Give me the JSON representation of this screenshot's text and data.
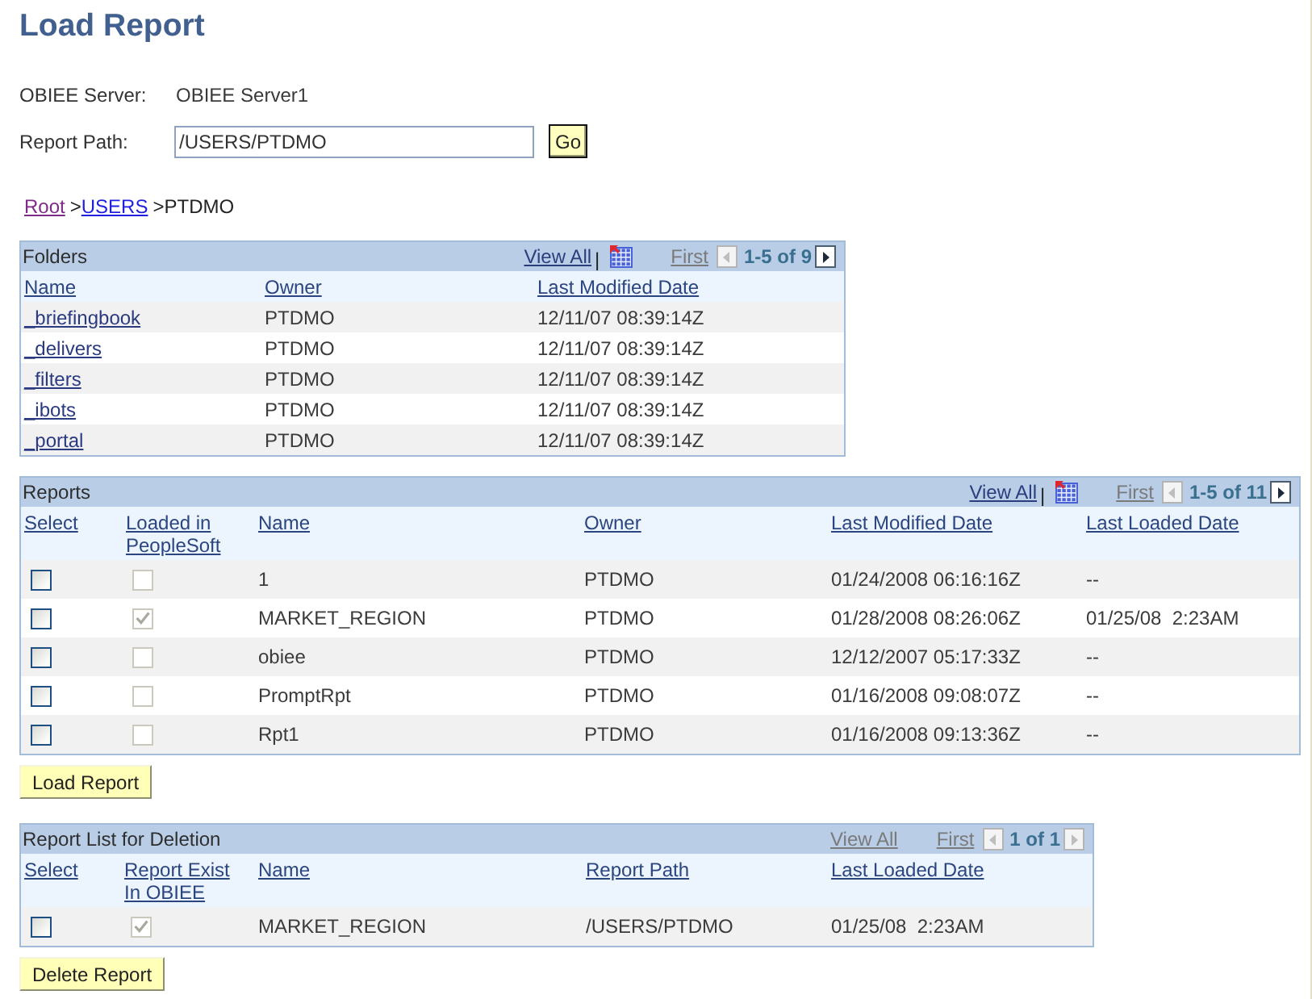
{
  "page": {
    "title": "Load Report"
  },
  "server": {
    "label": "OBIEE Server:",
    "value": "OBIEE Server1"
  },
  "report_path": {
    "label": "Report Path:",
    "value": "/USERS/PTDMO",
    "button": "Go"
  },
  "breadcrumb": [
    {
      "kind": "visited",
      "text": "Root"
    },
    {
      "kind": "separator",
      "text": ">"
    },
    {
      "kind": "link",
      "text": "USERS"
    },
    {
      "kind": "separator",
      "text": ">"
    },
    {
      "kind": "current",
      "text": "PTDMO"
    }
  ],
  "grids": [
    {
      "title": "Folders",
      "nav": {
        "view_all": "View All",
        "view_all_disabled": false,
        "separator": "|",
        "download_icon": true,
        "first": "First",
        "first_disabled": true,
        "prev_disabled": true,
        "range": "1-5 of 9",
        "next_disabled": false
      },
      "columns": [
        {
          "label": "Name",
          "kind": "link"
        },
        {
          "label": "Owner",
          "kind": "text"
        },
        {
          "label": "Last Modified Date",
          "kind": "text"
        }
      ],
      "rows": [
        [
          "_briefingbook",
          "PTDMO",
          "12/11/07 08:39:14Z"
        ],
        [
          "_delivers",
          "PTDMO",
          "12/11/07 08:39:14Z"
        ],
        [
          "_filters",
          "PTDMO",
          "12/11/07 08:39:14Z"
        ],
        [
          "_ibots",
          "PTDMO",
          "12/11/07 08:39:14Z"
        ],
        [
          "_portal",
          "PTDMO",
          "12/11/07 08:39:14Z"
        ]
      ]
    },
    {
      "title": "Reports",
      "nav": {
        "view_all": "View All",
        "view_all_disabled": false,
        "separator": "|",
        "download_icon": true,
        "first": "First",
        "first_disabled": true,
        "prev_disabled": true,
        "range": "1-5 of 11",
        "next_disabled": false
      },
      "columns": [
        {
          "label": "Select",
          "kind": "checkbox"
        },
        {
          "label": "Loaded in PeopleSoft",
          "kind": "readonly_checkbox"
        },
        {
          "label": "Name",
          "kind": "text"
        },
        {
          "label": "Owner",
          "kind": "text"
        },
        {
          "label": "Last Modified Date",
          "kind": "text"
        },
        {
          "label": "Last Loaded Date",
          "kind": "text"
        }
      ],
      "rows": [
        [
          {
            "checked": false
          },
          {
            "checked": false
          },
          "1",
          "PTDMO",
          "01/24/2008 06:16:16Z",
          "--"
        ],
        [
          {
            "checked": false
          },
          {
            "checked": true
          },
          "MARKET_REGION",
          "PTDMO",
          "01/28/2008 08:26:06Z",
          "01/25/08  2:23AM"
        ],
        [
          {
            "checked": false
          },
          {
            "checked": false
          },
          "obiee",
          "PTDMO",
          "12/12/2007 05:17:33Z",
          "--"
        ],
        [
          {
            "checked": false
          },
          {
            "checked": false
          },
          "PromptRpt",
          "PTDMO",
          "01/16/2008 09:08:07Z",
          "--"
        ],
        [
          {
            "checked": false
          },
          {
            "checked": false
          },
          "Rpt1",
          "PTDMO",
          "01/16/2008 09:13:36Z",
          "--"
        ]
      ],
      "button": "Load Report"
    },
    {
      "title": "Report List for Deletion",
      "nav": {
        "view_all": "View All",
        "view_all_disabled": true,
        "first": "First",
        "first_disabled": true,
        "prev_disabled": true,
        "range": "1 of 1",
        "next_disabled": true
      },
      "columns": [
        {
          "label": "Select",
          "kind": "checkbox"
        },
        {
          "label": "Report Exist In OBIEE",
          "kind": "readonly_checkbox"
        },
        {
          "label": "Name",
          "kind": "text"
        },
        {
          "label": "Report Path",
          "kind": "text"
        },
        {
          "label": "Last Loaded Date",
          "kind": "text"
        }
      ],
      "rows": [
        [
          {
            "checked": false
          },
          {
            "checked": true
          },
          "MARKET_REGION",
          "/USERS/PTDMO",
          "01/25/08  2:23AM"
        ]
      ],
      "button": "Delete Report"
    }
  ]
}
